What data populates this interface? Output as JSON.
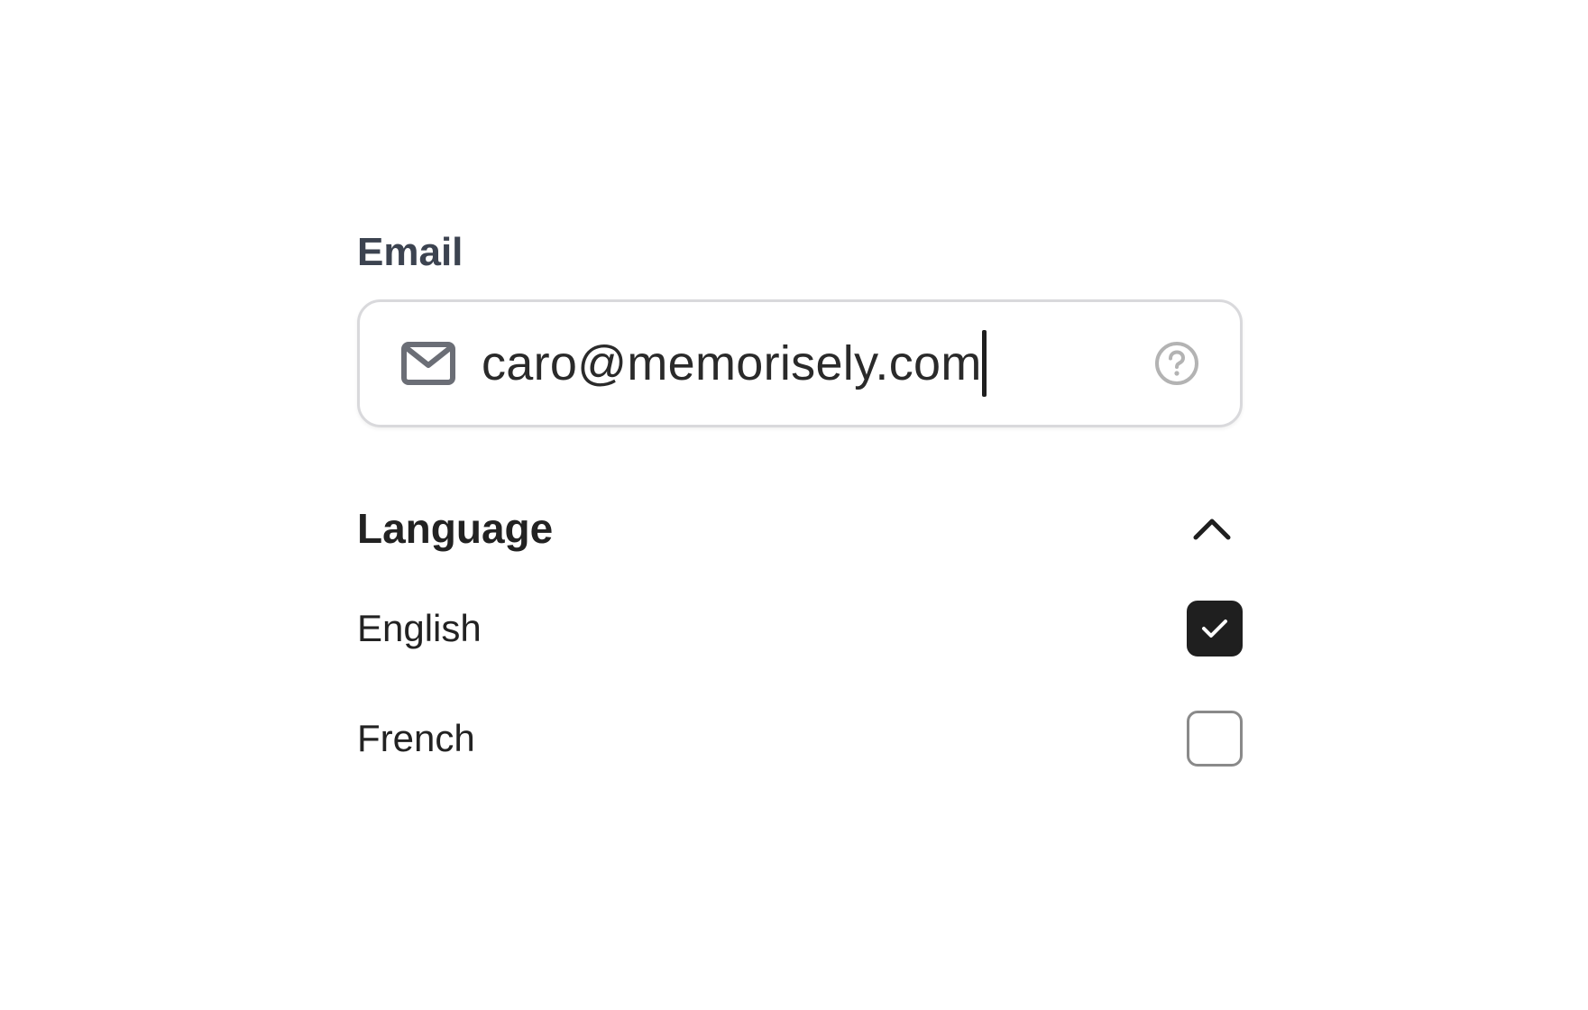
{
  "email": {
    "label": "Email",
    "value": "caro@memorisely.com",
    "leading_icon": "mail-icon",
    "trailing_icon": "help-circle-icon"
  },
  "language": {
    "title": "Language",
    "toggle_icon": "chevron-up-icon",
    "expanded": true,
    "options": [
      {
        "label": "English",
        "checked": true
      },
      {
        "label": "French",
        "checked": false
      }
    ]
  },
  "colors": {
    "label_text": "#3c4350",
    "input_border": "#d9d9dc",
    "checkbox_checked": "#1f1f1f",
    "icon_muted": "#b3b3b3",
    "mail_icon": "#6b6e76"
  }
}
